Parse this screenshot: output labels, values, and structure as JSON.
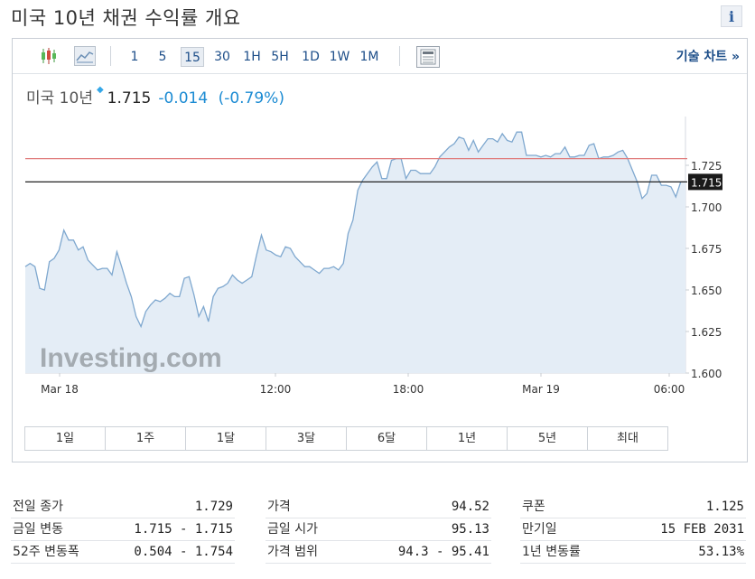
{
  "page": {
    "title": "미국 10년 채권 수익률 개요",
    "info_icon": "i"
  },
  "toolbar": {
    "timeframes": [
      "1",
      "5",
      "15",
      "30",
      "1H",
      "5H",
      "1D",
      "1W",
      "1M"
    ],
    "active_timeframe": "15",
    "tech_chart_link": "기술 차트 »"
  },
  "quote": {
    "name": "미국 10년",
    "price": "1.715",
    "change": "-0.014",
    "change_pct": "(-0.79%)"
  },
  "colors": {
    "accent": "#1d4e89",
    "change": "#1b8bd3",
    "line": "#7fa8cf",
    "area": "#e4edf6",
    "ref_line": "#e07b7b"
  },
  "chart_data": {
    "type": "area",
    "ylim": [
      1.6,
      1.733
    ],
    "yticks": [
      "1.725",
      "1.700",
      "1.675",
      "1.650",
      "1.625",
      "1.600"
    ],
    "xticks": [
      "Mar 18",
      "12:00",
      "18:00",
      "Mar 19",
      "06:00"
    ],
    "current_label": "1.715",
    "prev_close": 1.729,
    "current": 1.715,
    "watermark": "Investing.com",
    "values": [
      1.664,
      1.666,
      1.664,
      1.651,
      1.65,
      1.667,
      1.669,
      1.674,
      1.686,
      1.68,
      1.68,
      1.674,
      1.676,
      1.668,
      1.665,
      1.662,
      1.663,
      1.663,
      1.659,
      1.673,
      1.664,
      1.654,
      1.646,
      1.634,
      1.628,
      1.637,
      1.641,
      1.644,
      1.643,
      1.645,
      1.648,
      1.646,
      1.646,
      1.657,
      1.658,
      1.647,
      1.634,
      1.64,
      1.631,
      1.646,
      1.651,
      1.652,
      1.654,
      1.659,
      1.656,
      1.654,
      1.656,
      1.658,
      1.671,
      1.683,
      1.674,
      1.673,
      1.671,
      1.67,
      1.676,
      1.675,
      1.67,
      1.667,
      1.664,
      1.664,
      1.662,
      1.66,
      1.663,
      1.663,
      1.664,
      1.662,
      1.666,
      1.684,
      1.692,
      1.71,
      1.716,
      1.72,
      1.724,
      1.727,
      1.717,
      1.717,
      1.728,
      1.729,
      1.729,
      1.717,
      1.722,
      1.722,
      1.72,
      1.72,
      1.72,
      1.724,
      1.73,
      1.733,
      1.736,
      1.738,
      1.742,
      1.741,
      1.734,
      1.74,
      1.733,
      1.737,
      1.741,
      1.741,
      1.739,
      1.744,
      1.74,
      1.739,
      1.745,
      1.745,
      1.731,
      1.731,
      1.731,
      1.73,
      1.731,
      1.73,
      1.732,
      1.732,
      1.736,
      1.73,
      1.73,
      1.731,
      1.731,
      1.737,
      1.738,
      1.729,
      1.73,
      1.73,
      1.731,
      1.733,
      1.734,
      1.729,
      1.722,
      1.715,
      1.705,
      1.708,
      1.719,
      1.719,
      1.713,
      1.713,
      1.712,
      1.706,
      1.715,
      1.715
    ]
  },
  "range_buttons": [
    "1일",
    "1주",
    "1달",
    "3달",
    "6달",
    "1년",
    "5년",
    "최대"
  ],
  "stats": {
    "col1": [
      {
        "label": "전일 종가",
        "value": "1.729"
      },
      {
        "label": "금일 변동",
        "value": "1.715 - 1.715"
      },
      {
        "label": "52주 변동폭",
        "value": "0.504 - 1.754"
      }
    ],
    "col2": [
      {
        "label": "가격",
        "value": "94.52"
      },
      {
        "label": "금일 시가",
        "value": "95.13"
      },
      {
        "label": "가격 범위",
        "value": "94.3 - 95.41"
      }
    ],
    "col3": [
      {
        "label": "쿠폰",
        "value": "1.125"
      },
      {
        "label": "만기일",
        "value": "15 FEB 2031"
      },
      {
        "label": "1년 변동률",
        "value": "53.13%"
      }
    ]
  }
}
